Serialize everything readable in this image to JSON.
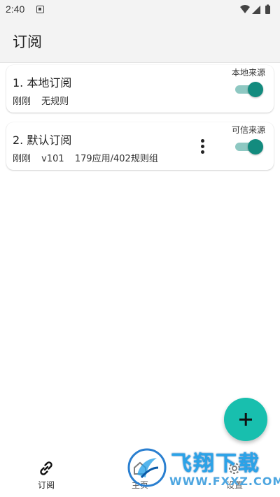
{
  "status_bar": {
    "time": "2:40",
    "icons": [
      "notification-icon",
      "wifi-icon",
      "signal-icon",
      "battery-icon"
    ]
  },
  "app_bar": {
    "title": "订阅"
  },
  "subscriptions": [
    {
      "title": "1. 本地订阅",
      "meta": [
        "刚刚",
        "无规则"
      ],
      "badge": "本地来源",
      "enabled": true,
      "has_menu": false
    },
    {
      "title": "2. 默认订阅",
      "meta": [
        "刚刚",
        "v101",
        "179应用/402规则组"
      ],
      "badge": "可信来源",
      "enabled": true,
      "has_menu": true
    }
  ],
  "fab": {
    "icon": "plus-icon"
  },
  "bottom_nav": [
    {
      "label": "订阅",
      "icon": "link-icon",
      "active": true
    },
    {
      "label": "主页",
      "icon": "home-icon",
      "active": false
    },
    {
      "label": "设置",
      "icon": "gear-icon",
      "active": false
    }
  ],
  "watermark": {
    "title": "飞翔下载",
    "url": "WWW.FXXZ.COM"
  },
  "colors": {
    "accent": "#18bfae",
    "toggle_thumb": "#138b7e",
    "toggle_track": "#8ec8c2",
    "app_bar_bg": "#f3f3f3"
  }
}
